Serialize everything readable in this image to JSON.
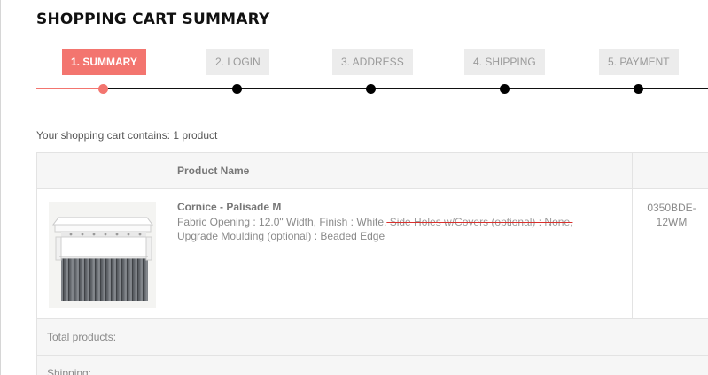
{
  "page": {
    "title": "SHOPPING CART SUMMARY"
  },
  "steps": [
    {
      "label": "1. Summary",
      "active": true
    },
    {
      "label": "2. Login",
      "active": false
    },
    {
      "label": "3. Address",
      "active": false
    },
    {
      "label": "4. Shipping",
      "active": false
    },
    {
      "label": "5. Payment",
      "active": false
    }
  ],
  "cart": {
    "count_text": "Your shopping cart contains: 1 product",
    "columns": [
      "",
      "Product Name",
      ""
    ],
    "items": [
      {
        "image_icon": "cornice-product-image",
        "name": "Cornice - Palisade M",
        "attrs_before_strike": "Fabric Opening : 12.0\" Width, Finish : White,",
        "attrs_strike": " Side Holes w/Covers (optional) : None, ",
        "attrs_line2": "Upgrade Moulding (optional) : Beaded Edge",
        "reference": "0350BDE-12WM"
      }
    ],
    "total_label": "Total products:",
    "shipping_label": "Shipping:"
  },
  "colors": {
    "accent": "#f3756f",
    "strike": "#d9302c"
  }
}
